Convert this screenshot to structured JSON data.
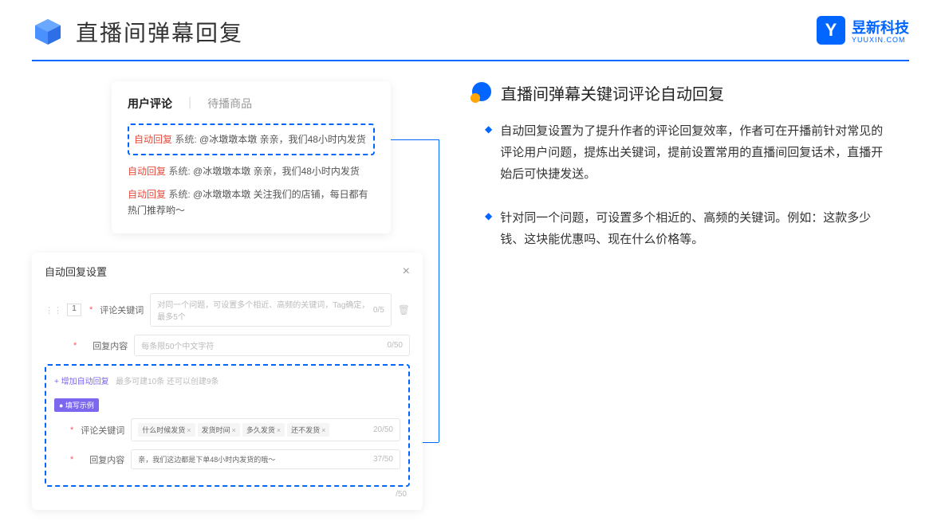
{
  "header": {
    "title": "直播间弹幕回复"
  },
  "brand": {
    "name": "昱新科技",
    "url": "YUUXIN.COM",
    "iconLetter": "Y"
  },
  "commentPanel": {
    "tabs": {
      "active": "用户评论",
      "inactive": "待播商品"
    },
    "highlighted": {
      "tag": "自动回复",
      "sys": "系统:",
      "text": "@冰墩墩本墩 亲亲，我们48小时内发货"
    },
    "items": [
      {
        "tag": "自动回复",
        "sys": "系统:",
        "text": "@冰墩墩本墩 亲亲，我们48小时内发货"
      },
      {
        "tag": "自动回复",
        "sys": "系统:",
        "text": "@冰墩墩本墩 关注我们的店铺，每日都有热门推荐哟～"
      }
    ]
  },
  "settings": {
    "title": "自动回复设置",
    "rowNum": "1",
    "keywordLabel": "评论关键词",
    "keywordPlaceholder": "对同一个问题，可设置多个相近、高频的关键词，Tag确定，最多5个",
    "keywordCount": "0/5",
    "contentLabel": "回复内容",
    "contentPlaceholder": "每条限50个中文字符",
    "contentCount": "0/50",
    "addLink": "+ 增加自动回复",
    "addNote": "最多可建10条 还可以创建9条",
    "exampleTag": "● 填写示例",
    "exKeywordLabel": "评论关键词",
    "exTags": [
      "什么时候发货",
      "发货时间",
      "多久发货",
      "还不发货"
    ],
    "exKeywordCount": "20/50",
    "exContentLabel": "回复内容",
    "exContentText": "亲，我们这边都是下单48小时内发货的哦～",
    "exContentCount": "37/50",
    "extraCount": "/50"
  },
  "right": {
    "sectionTitle": "直播间弹幕关键词评论自动回复",
    "bullets": [
      "自动回复设置为了提升作者的评论回复效率，作者可在开播前针对常见的评论用户问题，提炼出关键词，提前设置常用的直播间回复话术，直播开始后可快捷发送。",
      "针对同一个问题，可设置多个相近的、高频的关键词。例如：这款多少钱、这块能优惠吗、现在什么价格等。"
    ]
  }
}
